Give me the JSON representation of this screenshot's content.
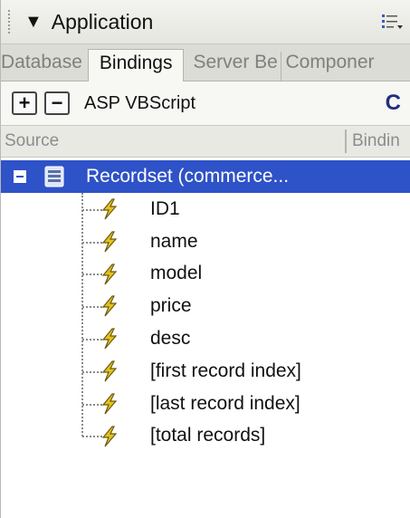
{
  "panel": {
    "title": "Application",
    "title_arrow": "▼"
  },
  "tabs": [
    {
      "label": "Database",
      "active": false
    },
    {
      "label": "Bindings",
      "active": true
    },
    {
      "label": "Server Be",
      "active": false
    },
    {
      "label": "Componer",
      "active": false
    }
  ],
  "toolbar": {
    "add_label": "+",
    "remove_label": "−",
    "document_type": "ASP VBScript",
    "right_label": "C"
  },
  "columns": {
    "source": "Source",
    "binding": "Bindin"
  },
  "recordset": {
    "label": "Recordset (commerce...",
    "selected": true,
    "fields": [
      "ID1",
      "name",
      "model",
      "price",
      "desc",
      "[first record index]",
      "[last record index]",
      "[total records]"
    ]
  },
  "colors": {
    "selection": "#2e52c7",
    "bolt": "#e2c21e"
  }
}
